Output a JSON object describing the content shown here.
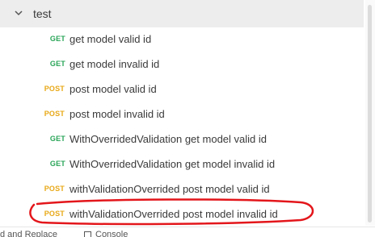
{
  "collection": {
    "folder_name": "test",
    "requests": [
      {
        "method": "GET",
        "name": "get model valid id",
        "method_color": "#2aa558"
      },
      {
        "method": "GET",
        "name": "get model invalid id",
        "method_color": "#2aa558"
      },
      {
        "method": "POST",
        "name": "post model valid id",
        "method_color": "#e8a817"
      },
      {
        "method": "POST",
        "name": "post model invalid id",
        "method_color": "#e8a817"
      },
      {
        "method": "GET",
        "name": "WithOverridedValidation get model valid id",
        "method_color": "#2aa558"
      },
      {
        "method": "GET",
        "name": "WithOverridedValidation get model invalid id",
        "method_color": "#2aa558"
      },
      {
        "method": "POST",
        "name": "withValidationOverrided post model valid id",
        "method_color": "#e8a817"
      },
      {
        "method": "POST",
        "name": "withValidationOverrided post model invalid id",
        "method_color": "#e8a817"
      }
    ]
  },
  "bottom_bar": {
    "find_replace_label": "d and Replace",
    "console_label": "Console"
  },
  "colors": {
    "annotation": "#e3161b",
    "folder_bg": "#ededed"
  }
}
